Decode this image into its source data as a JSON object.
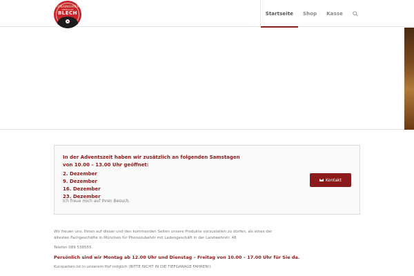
{
  "logo": {
    "line1": "TONABNEHMER",
    "line2": "SPEZIALIST",
    "line3": "BLECH"
  },
  "nav": {
    "items": [
      {
        "label": "Startseite",
        "active": true
      },
      {
        "label": "Shop",
        "active": false
      },
      {
        "label": "Kasse",
        "active": false
      }
    ],
    "search_icon": "search-icon"
  },
  "notice": {
    "heading_line1": "In der Adventszeit haben wir zusätzlich an folgenden Samstagen",
    "heading_line2": "von 10.00 – 13.00 Uhr geöffnet:",
    "dates": [
      "2. Dezember",
      "9. Dezember",
      "16. Dezember",
      "23. Dezember"
    ],
    "footer": "Ich freue mich auf Ihren Besuch.",
    "button_label": "Kontakt",
    "button_icon": "mail-icon"
  },
  "intro": {
    "line1": "Wir freuen uns, Ihnen auf dieser und den kommenden Seiten unsere Produkte  vorzustellen zu dürfen, als eines der",
    "line2": "ältesten Fachgeschäfte in München für Phonozubehör mit Ladengeschäft in der Landwehrstr. 48",
    "phone": "Telefon 089 538555.",
    "hours": "Persönlich sind wir Montag ab 12.00 Uhr und Dienstag – Freitag von 10.00 – 17.00 Uhr für Sie da.",
    "parking": "Kurzparken ist in unserem Hof möglich (BITTE NICHT IN DIE TIEFGARAGE FAHREN!)"
  },
  "colors": {
    "accent": "#8b1a1a",
    "logo_red": "#c8242b"
  }
}
